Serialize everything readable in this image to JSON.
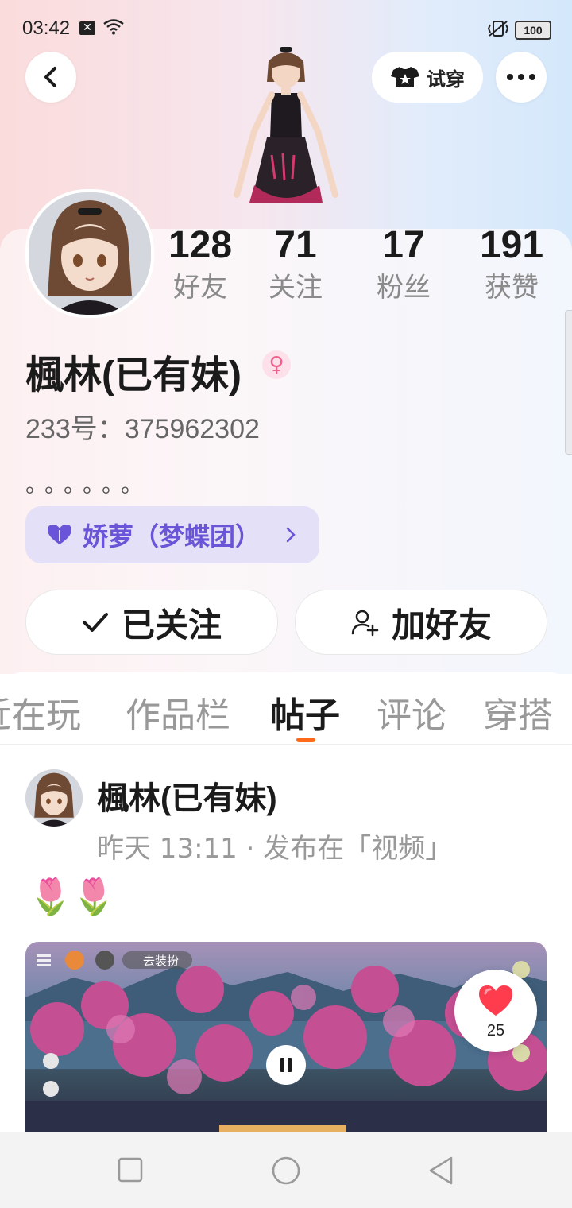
{
  "status_bar": {
    "time": "03:42",
    "battery": "100"
  },
  "header": {
    "tryon_label": "试穿"
  },
  "stats": [
    {
      "value": "128",
      "label": "好友"
    },
    {
      "value": "71",
      "label": "关注"
    },
    {
      "value": "17",
      "label": "粉丝"
    },
    {
      "value": "191",
      "label": "获赞"
    }
  ],
  "profile": {
    "name": "楓林(已有妹)",
    "gender_icon": "female-icon",
    "id_text": "233号：375962302",
    "bio": "。。。。。。",
    "group_label": "娇萝（梦蝶团）"
  },
  "actions": {
    "follow_label": "已关注",
    "add_friend_label": "加好友"
  },
  "tabs": [
    "近在玩",
    "作品栏",
    "帖子",
    "评论",
    "穿搭"
  ],
  "active_tab": "帖子",
  "post": {
    "author": "楓林(已有妹)",
    "meta": "昨天 13:11 · 发布在「视频」",
    "text": "🌷🌷",
    "like_count": "25",
    "video_overlay_tag": "去装扮"
  },
  "colors": {
    "accent": "#ff6a1a",
    "group_pill_bg": "#e4e0f8",
    "group_pill_text": "#6a55d9",
    "heart": "#ff3b4e"
  }
}
